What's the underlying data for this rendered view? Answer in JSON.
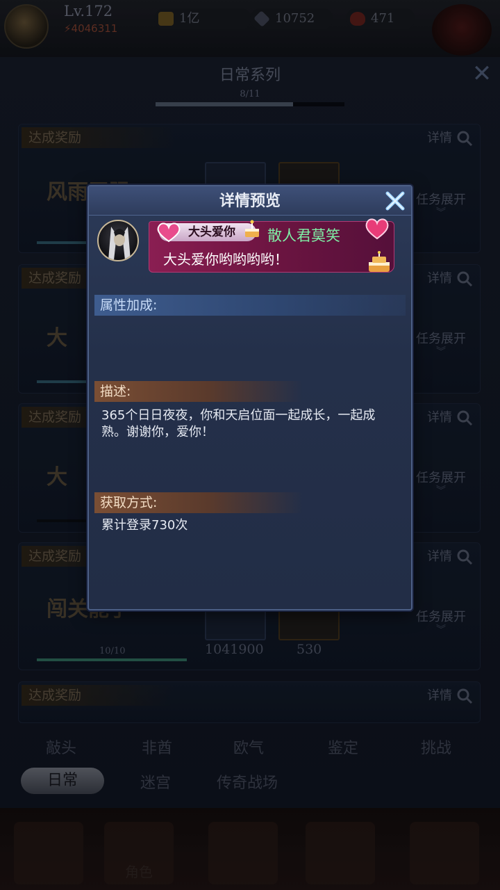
{
  "topbar": {
    "level": "Lv.172",
    "power": "4046311",
    "gold": "1亿",
    "gems": "10752",
    "energy": "471"
  },
  "panel": {
    "title": "日常系列",
    "progress_label": "8/11",
    "progress_fraction": 0.727
  },
  "cards": [
    {
      "tag": "达成奖励",
      "detail": "详情",
      "expand": "任务展开",
      "title": "风雨无阻"
    },
    {
      "tag": "达成奖励",
      "detail": "详情",
      "expand": "任务展开",
      "title": "大"
    },
    {
      "tag": "达成奖励",
      "detail": "详情",
      "expand": "任务展开",
      "title": "大"
    },
    {
      "tag": "达成奖励",
      "detail": "详情",
      "expand": "任务展开",
      "title": "闯关能手",
      "count": "10/10",
      "reward1": "1041900",
      "reward2": "530"
    },
    {
      "tag": "达成奖励",
      "detail": "详情"
    }
  ],
  "tabs_row1": [
    "敲头",
    "非酋",
    "欧气",
    "鉴定",
    "挑战"
  ],
  "tabs_row2": {
    "active": "日常",
    "items": [
      "迷宫",
      "传奇战场"
    ]
  },
  "bottom_nav": [
    "角色"
  ],
  "modal": {
    "title": "详情预览",
    "bubble_name": "大头爱你",
    "bubble_user": "散人君莫笑",
    "bubble_text": "大头爱你哟哟哟哟！",
    "attr_heading": "属性加成:",
    "desc_heading": "描述:",
    "desc_text": "365个日日夜夜，你和天启位面一起成长，一起成熟。谢谢你，爱你！",
    "how_heading": "获取方式:",
    "how_text": "累计登录730次"
  },
  "colors": {
    "modal_bg": "#24304a",
    "bubble_bg": "#6a1440",
    "user_name": "#7ff0a6",
    "section_orange": "#7a4e34",
    "section_blue": "#3e5c8e"
  }
}
